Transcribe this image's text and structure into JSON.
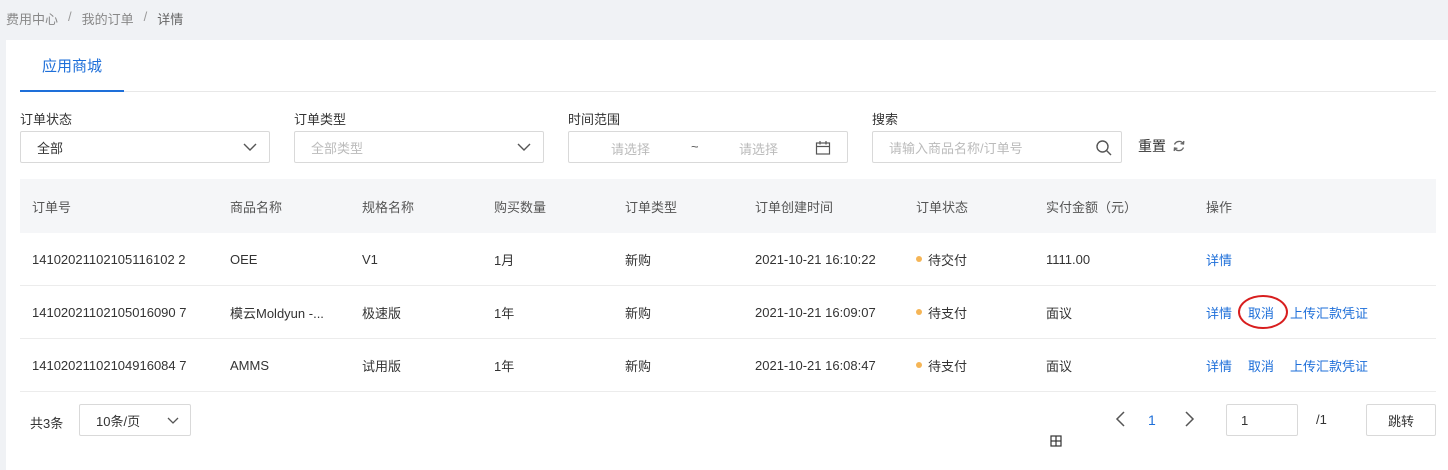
{
  "breadcrumb": {
    "items": [
      "费用中心",
      "我的订单",
      "详情"
    ],
    "sep": "/"
  },
  "tabs": [
    {
      "label": "应用商城",
      "active": true
    }
  ],
  "filters": {
    "status": {
      "label": "订单状态",
      "value": "全部"
    },
    "type": {
      "label": "订单类型",
      "placeholder": "全部类型"
    },
    "time": {
      "label": "时间范围",
      "start_placeholder": "请选择",
      "separator": "~",
      "end_placeholder": "请选择"
    },
    "search": {
      "label": "搜索",
      "placeholder": "请输入商品名称/订单号"
    },
    "reset_label": "重置"
  },
  "table": {
    "headers": [
      "订单号",
      "商品名称",
      "规格名称",
      "购买数量",
      "订单类型",
      "订单创建时间",
      "订单状态",
      "实付金额（元）",
      "操作"
    ],
    "rows": [
      {
        "order_no": "14102021102105116102 2",
        "product": "OEE",
        "spec": "V1",
        "qty": "1月",
        "type": "新购",
        "created": "2021-10-21 16:10:22",
        "status": "待交付",
        "amount": "1111.00",
        "actions": [
          "详情"
        ]
      },
      {
        "order_no": "14102021102105016090 7",
        "product": "模云Moldyun -...",
        "spec": "极速版",
        "qty": "1年",
        "type": "新购",
        "created": "2021-10-21 16:09:07",
        "status": "待支付",
        "amount": "面议",
        "actions": [
          "详情",
          "取消",
          "上传汇款凭证"
        ]
      },
      {
        "order_no": "14102021102104916084 7",
        "product": "AMMS",
        "spec": "试用版",
        "qty": "1年",
        "type": "新购",
        "created": "2021-10-21 16:08:47",
        "status": "待支付",
        "amount": "面议",
        "actions": [
          "详情",
          "取消",
          "上传汇款凭证"
        ]
      }
    ]
  },
  "pagination": {
    "total_text": "共3条",
    "page_size": "10条/页",
    "current_page": "1",
    "jump_value": "1",
    "total_pages": "/1",
    "jump_label": "跳转"
  },
  "colors": {
    "accent": "#1e6fd9",
    "status_dot": "#f5b556",
    "highlight_circle": "#d81e1e"
  }
}
